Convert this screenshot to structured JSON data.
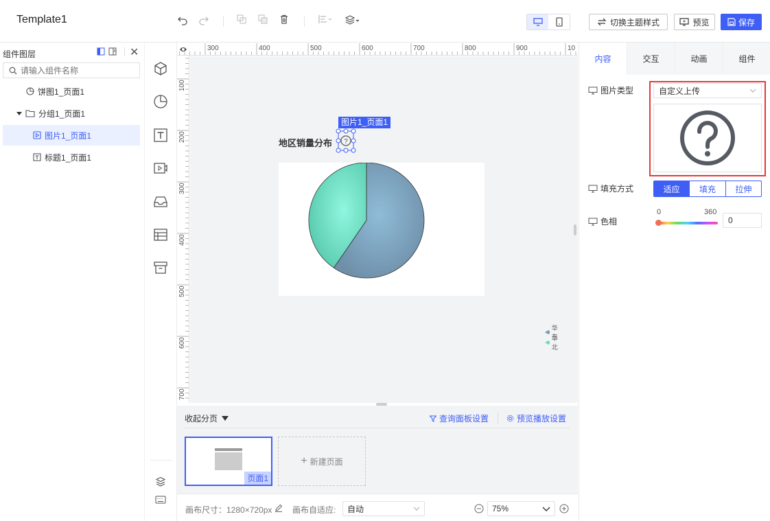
{
  "app": {
    "title": "Template1"
  },
  "toolbar": {
    "switch_theme_label": "切换主题样式",
    "preview_label": "预览",
    "save_label": "保存",
    "icons": [
      "undo-icon",
      "redo-icon",
      "copy-icon",
      "paste-icon",
      "delete-icon",
      "align-icon",
      "layer-order-icon",
      "desktop-icon",
      "mobile-icon"
    ]
  },
  "left_panel": {
    "title": "组件图层",
    "search_placeholder": "请输入组件名称",
    "tree": [
      {
        "label": "饼图1_页面1",
        "icon": "pie-chart-icon"
      },
      {
        "label": "分组1_页面1",
        "icon": "folder-icon"
      },
      {
        "label": "图片1_页面1",
        "icon": "image-icon",
        "selected": true
      },
      {
        "label": "标题1_页面1",
        "icon": "text-icon"
      }
    ]
  },
  "tool_strip": {
    "icons": [
      "cube-icon",
      "pie-chart-icon",
      "text-icon",
      "video-icon",
      "inbox-icon",
      "table-icon",
      "archive-icon",
      "layers-icon",
      "keyboard-icon"
    ]
  },
  "ruler": {
    "top_labels": [
      "300",
      "400",
      "500",
      "600",
      "700",
      "800",
      "900",
      "10"
    ],
    "left_labels": [
      "100",
      "200",
      "300",
      "400",
      "500",
      "600",
      "700"
    ]
  },
  "canvas": {
    "chart_title": "地区销量分布",
    "selection_label": "图片1_页面1",
    "legend": [
      {
        "name": "华东",
        "color": "#7a9bb6"
      },
      {
        "name": "华北",
        "color": "#6fdcc0"
      }
    ]
  },
  "chart_data": {
    "type": "pie",
    "title": "地区销量分布",
    "series": [
      {
        "name": "华东",
        "value": 59.6,
        "color": "#7a9bb6"
      },
      {
        "name": "华北",
        "value": 40.4,
        "color": "#6fdcc0"
      }
    ],
    "legend_position": "right"
  },
  "pages_panel": {
    "collapse_label": "收起分页",
    "query_settings_label": "查询面板设置",
    "playback_settings_label": "预览播放设置",
    "page_badge": "页面1",
    "new_page_label": "新建页面"
  },
  "status_bar": {
    "canvas_size_label": "画布尺寸：1280×720px",
    "auto_fit_label": "画布自适应:",
    "auto_fit_value": "自动",
    "zoom_value": "75%"
  },
  "right_panel": {
    "tabs": [
      "内容",
      "交互",
      "动画",
      "组件"
    ],
    "image_type_label": "图片类型",
    "image_type_value": "自定义上传",
    "fill_mode_label": "填充方式",
    "fill_modes": [
      "适应",
      "填充",
      "拉伸"
    ],
    "hue_label": "色相",
    "hue_min": "0",
    "hue_max": "360",
    "hue_value": "0"
  },
  "colors": {
    "accent": "#3e5ef5",
    "highlight": "#e53935"
  }
}
